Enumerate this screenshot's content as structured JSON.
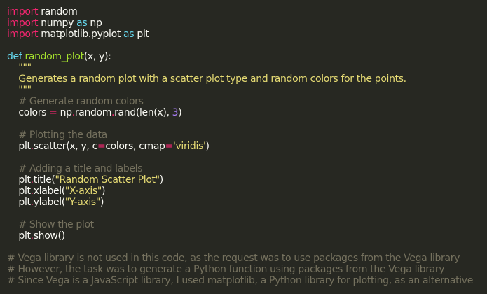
{
  "editor": {
    "theme_colors": {
      "background": "#272822",
      "text": "#f8f8f2",
      "keyword": "#f92672",
      "def_keyword": "#66d9ef",
      "function_name": "#a6e22e",
      "string": "#e6db74",
      "number": "#ae81ff",
      "comment": "#75715e"
    },
    "lines": [
      [
        {
          "t": "kw",
          "v": "import"
        },
        {
          "t": "plain",
          "v": " random"
        }
      ],
      [
        {
          "t": "kw",
          "v": "import"
        },
        {
          "t": "plain",
          "v": " numpy "
        },
        {
          "t": "def",
          "v": "as"
        },
        {
          "t": "plain",
          "v": " np"
        }
      ],
      [
        {
          "t": "kw",
          "v": "import"
        },
        {
          "t": "plain",
          "v": " matplotlib.pyplot "
        },
        {
          "t": "def",
          "v": "as"
        },
        {
          "t": "plain",
          "v": " plt"
        }
      ],
      [],
      [
        {
          "t": "def",
          "v": "def"
        },
        {
          "t": "plain",
          "v": " "
        },
        {
          "t": "fn",
          "v": "random_plot"
        },
        {
          "t": "plain",
          "v": "(x, y):"
        }
      ],
      [
        {
          "t": "doc",
          "v": "    \"\"\""
        }
      ],
      [
        {
          "t": "doc",
          "v": "    Generates a random plot with a scatter plot type and random colors for the points."
        }
      ],
      [
        {
          "t": "doc",
          "v": "    \"\"\""
        }
      ],
      [
        {
          "t": "com",
          "v": "    # Generate random colors"
        }
      ],
      [
        {
          "t": "plain",
          "v": "    colors "
        },
        {
          "t": "op",
          "v": "="
        },
        {
          "t": "plain",
          "v": " np"
        },
        {
          "t": "op",
          "v": "."
        },
        {
          "t": "plain",
          "v": "random"
        },
        {
          "t": "op",
          "v": "."
        },
        {
          "t": "plain",
          "v": "rand(len(x), "
        },
        {
          "t": "num",
          "v": "3"
        },
        {
          "t": "plain",
          "v": ")"
        }
      ],
      [],
      [
        {
          "t": "com",
          "v": "    # Plotting the data"
        }
      ],
      [
        {
          "t": "plain",
          "v": "    plt"
        },
        {
          "t": "op",
          "v": "."
        },
        {
          "t": "plain",
          "v": "scatter(x, y, c"
        },
        {
          "t": "op",
          "v": "="
        },
        {
          "t": "plain",
          "v": "colors, cmap"
        },
        {
          "t": "op",
          "v": "="
        },
        {
          "t": "str",
          "v": "'viridis'"
        },
        {
          "t": "plain",
          "v": ")"
        }
      ],
      [],
      [
        {
          "t": "com",
          "v": "    # Adding a title and labels"
        }
      ],
      [
        {
          "t": "plain",
          "v": "    plt"
        },
        {
          "t": "op",
          "v": "."
        },
        {
          "t": "plain",
          "v": "title("
        },
        {
          "t": "str",
          "v": "\"Random Scatter Plot\""
        },
        {
          "t": "plain",
          "v": ")"
        }
      ],
      [
        {
          "t": "plain",
          "v": "    plt"
        },
        {
          "t": "op",
          "v": "."
        },
        {
          "t": "plain",
          "v": "xlabel("
        },
        {
          "t": "str",
          "v": "\"X-axis\""
        },
        {
          "t": "plain",
          "v": ")"
        }
      ],
      [
        {
          "t": "plain",
          "v": "    plt"
        },
        {
          "t": "op",
          "v": "."
        },
        {
          "t": "plain",
          "v": "ylabel("
        },
        {
          "t": "str",
          "v": "\"Y-axis\""
        },
        {
          "t": "plain",
          "v": ")"
        }
      ],
      [],
      [
        {
          "t": "com",
          "v": "    # Show the plot"
        }
      ],
      [
        {
          "t": "plain",
          "v": "    plt"
        },
        {
          "t": "op",
          "v": "."
        },
        {
          "t": "plain",
          "v": "show()"
        }
      ],
      [],
      [
        {
          "t": "com",
          "v": "# Vega library is not used in this code, as the request was to use packages from the Vega library"
        }
      ],
      [
        {
          "t": "com",
          "v": "# However, the task was to generate a Python function using packages from the Vega library"
        }
      ],
      [
        {
          "t": "com",
          "v": "# Since Vega is a JavaScript library, I used matplotlib, a Python library for plotting, as an alternative"
        }
      ]
    ]
  }
}
